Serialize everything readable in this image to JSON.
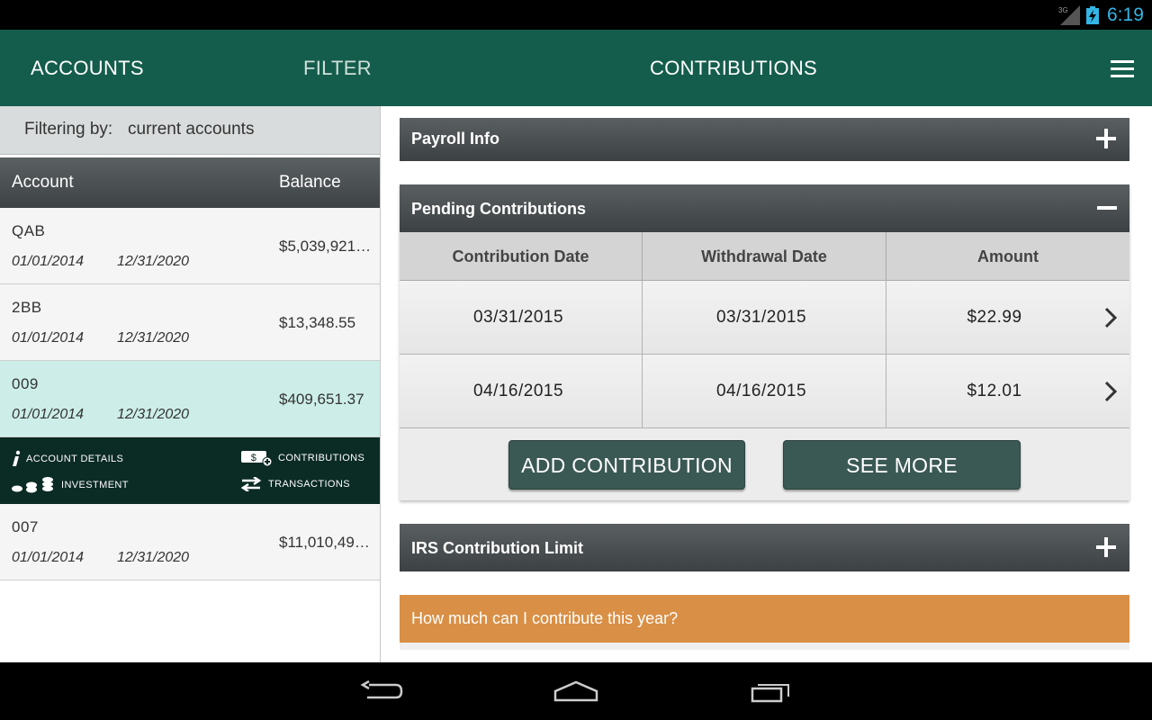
{
  "status_bar": {
    "network": "3G",
    "time": "6:19",
    "time_color": "#33b5e5"
  },
  "app_bar": {
    "tabs": [
      {
        "label": "ACCOUNTS"
      },
      {
        "label": "FILTER"
      },
      {
        "label": "CONTRIBUTIONS"
      }
    ],
    "menu_icon": "hamburger-menu-icon",
    "color": "#145d4c"
  },
  "filter": {
    "label": "Filtering by:",
    "value": "current accounts"
  },
  "accounts_table": {
    "headers": {
      "account": "Account",
      "balance": "Balance"
    },
    "rows": [
      {
        "name": "QAB",
        "start": "01/01/2014",
        "end": "12/31/2020",
        "balance": "$5,039,921…"
      },
      {
        "name": "2BB",
        "start": "01/01/2014",
        "end": "12/31/2020",
        "balance": "$13,348.55"
      },
      {
        "name": "009",
        "start": "01/01/2014",
        "end": "12/31/2020",
        "balance": "$409,651.37",
        "selected": true
      },
      {
        "name": "007",
        "start": "01/01/2014",
        "end": "12/31/2020",
        "balance": "$11,010,49…"
      }
    ],
    "actions": {
      "account_details": "ACCOUNT DETAILS",
      "contributions": "CONTRIBUTIONS",
      "investment": "INVESTMENT",
      "transactions": "TRANSACTIONS"
    }
  },
  "main": {
    "payroll_info": {
      "title": "Payroll Info",
      "icon": "plus-icon"
    },
    "pending": {
      "title": "Pending Contributions",
      "icon": "minus-icon",
      "columns": [
        "Contribution Date",
        "Withdrawal Date",
        "Amount"
      ],
      "rows": [
        {
          "contribution_date": "03/31/2015",
          "withdrawal_date": "03/31/2015",
          "amount": "$22.99"
        },
        {
          "contribution_date": "04/16/2015",
          "withdrawal_date": "04/16/2015",
          "amount": "$12.01"
        }
      ],
      "add_button": "ADD CONTRIBUTION",
      "see_more_button": "SEE MORE"
    },
    "irs_limit": {
      "title": "IRS Contribution Limit",
      "icon": "plus-icon"
    },
    "how_much": {
      "label": "How much can I contribute this year?",
      "color": "#d98f45"
    }
  },
  "nav_bar": {
    "icons": [
      "back-icon",
      "home-icon",
      "recent-apps-icon"
    ]
  }
}
